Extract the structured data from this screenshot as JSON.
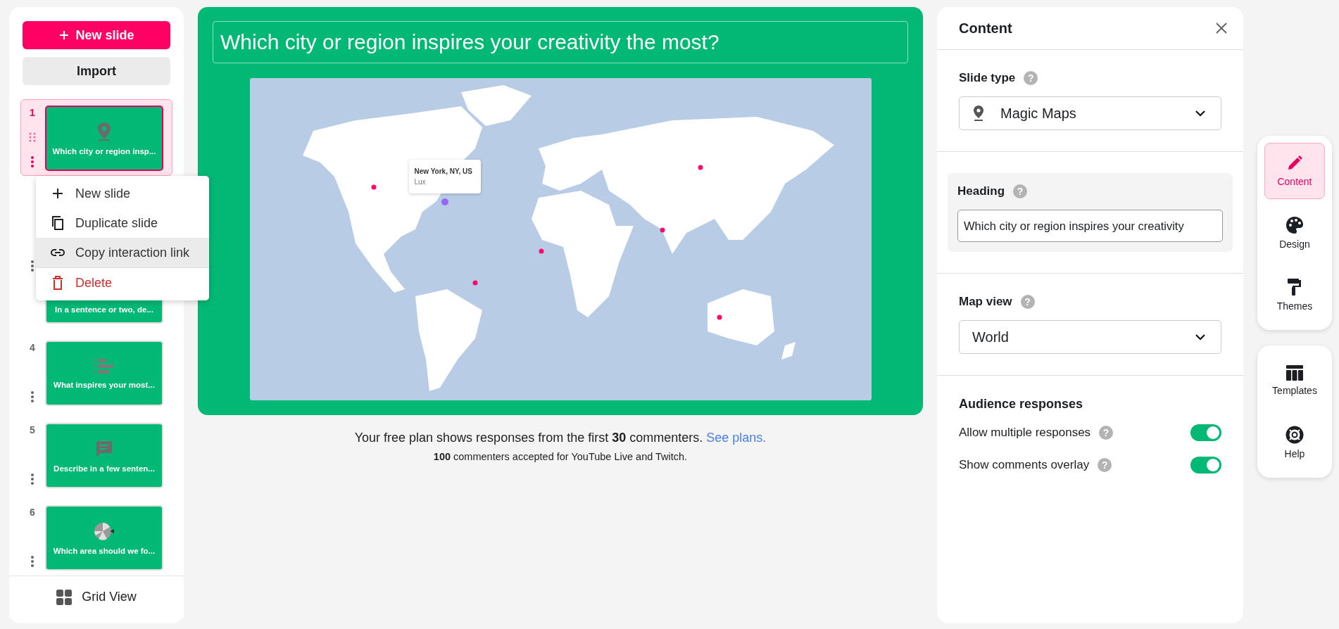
{
  "sidebar": {
    "new_slide_button": "New slide",
    "import_button": "Import",
    "slides": [
      {
        "number": "1",
        "title": "Which city or region insp...",
        "kind": "map",
        "selected": true
      },
      {
        "title": "In a sentence or two, de...",
        "kind": "hidden",
        "selected": false
      },
      {
        "number": "4",
        "title": "What inspires your most...",
        "kind": "ranking",
        "selected": false
      },
      {
        "number": "5",
        "title": "Describe in a few senten...",
        "kind": "openended",
        "selected": false
      },
      {
        "number": "6",
        "title": "Which area should we fo...",
        "kind": "wheel",
        "selected": false
      }
    ],
    "context_menu": [
      {
        "label": "New slide",
        "kind": "add",
        "selected": false
      },
      {
        "label": "Duplicate slide",
        "kind": "duplicate",
        "selected": false
      },
      {
        "label": "Copy interaction link",
        "kind": "link",
        "selected": true
      },
      {
        "label": "Delete",
        "kind": "delete",
        "selected": false
      }
    ],
    "grid_view_button": "Grid View"
  },
  "slide": {
    "heading": "Which city or region inspires your creativity the most?",
    "tooltip": {
      "place": "New York, NY, US",
      "name": "Lux"
    }
  },
  "notice": {
    "line_1": "Your free plan shows responses from the first **30** commenters.",
    "link": "See plans.",
    "line_2": "**100** commenters accepted for YouTube Live and Twitch."
  },
  "panel": {
    "title": "Content",
    "slide_type_label": "Slide type",
    "slide_type_help": "?",
    "slide_type": "Magic Maps",
    "heading_label": "Heading",
    "heading_help": "?",
    "heading_value": "Which city or region inspires your creativity",
    "map_view_label": "Map view",
    "map_view_help": "?",
    "map_view": "World",
    "audience_title": "Audience responses",
    "toggles": [
      {
        "label": "Allow multiple responses",
        "help": "?",
        "on": true
      },
      {
        "label": "Show comments overlay",
        "help": "?",
        "on": true
      }
    ]
  },
  "toolbar": [
    [
      {
        "label": "Content",
        "kind": "content",
        "selected": true
      },
      {
        "label": "Design",
        "kind": "design",
        "selected": false
      },
      {
        "label": "Themes",
        "kind": "themes",
        "selected": false
      }
    ],
    [
      {
        "label": "Templates",
        "kind": "templates",
        "selected": false
      },
      {
        "label": "Help",
        "kind": "help",
        "selected": false
      }
    ]
  ]
}
